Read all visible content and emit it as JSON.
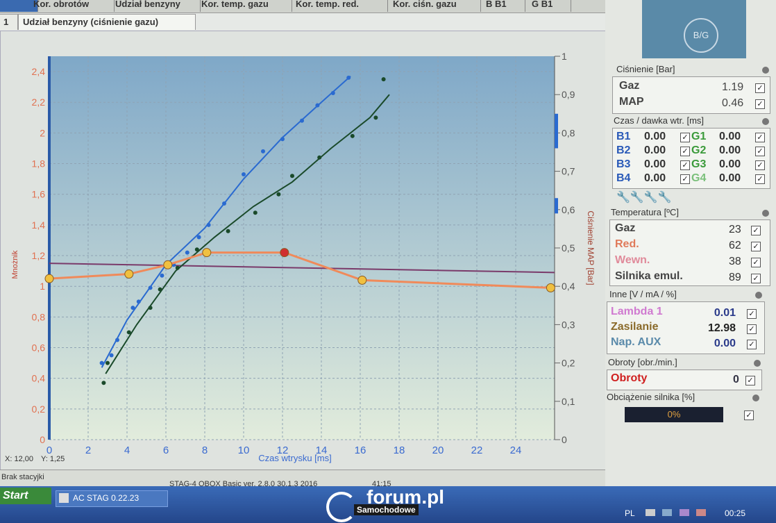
{
  "tabs": [
    "Kor. obrotów",
    "Udział benzyny",
    "Kor. temp. gazu",
    "Kor. temp. red.",
    "Kor. ciśn. gazu",
    "B B1",
    "G B1"
  ],
  "subtabs": [
    "1",
    "Udział benzyny (ciśnienie gazu)"
  ],
  "cursor_readout": {
    "x": "X: 12,00",
    "y": "Y: 1,25"
  },
  "status_left": "Brak stacyjki",
  "version": "STAG-4 QBOX Basic  ver. 2.8.0  30.1.3  2016",
  "time_partial": "41:15",
  "taskbar": {
    "start": "Start",
    "app": "AC STAG 0.22.23",
    "lang": "PL",
    "clock": "00:25"
  },
  "watermark": {
    "main": "forum.pl",
    "sub": "Samochodowe"
  },
  "logo": "B/G",
  "pressure": {
    "title": "Ciśnienie [Bar]",
    "rows": [
      {
        "label": "Gaz",
        "value": "1.19"
      },
      {
        "label": "MAP",
        "value": "0.46"
      }
    ]
  },
  "injection": {
    "title": "Czas / dawka wtr. [ms]",
    "rows": [
      {
        "b": "B1",
        "bv": "0.00",
        "g": "G1",
        "gv": "0.00"
      },
      {
        "b": "B2",
        "bv": "0.00",
        "g": "G2",
        "gv": "0.00"
      },
      {
        "b": "B3",
        "bv": "0.00",
        "g": "G3",
        "gv": "0.00"
      },
      {
        "b": "B4",
        "bv": "0.00",
        "g": "G4",
        "gv": "0.00"
      }
    ]
  },
  "temperature": {
    "title": "Temperatura [ºC]",
    "rows": [
      {
        "label": "Gaz",
        "value": "23",
        "color": "#444444"
      },
      {
        "label": "Red.",
        "value": "62",
        "color": "#e07a5a"
      },
      {
        "label": "Wewn.",
        "value": "38",
        "color": "#e08a9a"
      },
      {
        "label": "Silnika emul.",
        "value": "89",
        "color": "#444444"
      }
    ]
  },
  "other": {
    "title": "Inne [V / mA / %]",
    "rows": [
      {
        "label": "Lambda 1",
        "value": "0.01",
        "color": "#d07ad0"
      },
      {
        "label": "Zasilanie",
        "value": "12.98",
        "color": "#8a6a2a"
      },
      {
        "label": "Nap. AUX",
        "value": "0.00",
        "color": "#5a8aaa"
      }
    ]
  },
  "rpm": {
    "title": "Obroty [obr./min.]",
    "label": "Obroty",
    "value": "0"
  },
  "load": {
    "title": "Obciążenie silnika [%]",
    "value": "0%",
    "fraction": 0
  },
  "chart_data": {
    "type": "scatter",
    "xlabel": "Czas wtrysku [ms]",
    "ylabel_left": "Mnożnik",
    "ylabel_right": "Ciśnienie MAP [Bar]",
    "xlim": [
      0,
      26
    ],
    "ylim": [
      0,
      2.5
    ],
    "y2lim": [
      0,
      1
    ],
    "xticks": [
      0,
      2,
      4,
      6,
      8,
      10,
      12,
      14,
      16,
      18,
      20,
      22,
      24
    ],
    "yticks": [
      0,
      0.2,
      0.4,
      0.6,
      0.8,
      1,
      1.2,
      1.4,
      1.6,
      1.8,
      2,
      2.2,
      2.4
    ],
    "ytick_labels": [
      "0",
      "0,2",
      "0,4",
      "0,6",
      "0,8",
      "1",
      "1,2",
      "1,4",
      "1,6",
      "1,8",
      "2",
      "2,2",
      "2,4"
    ],
    "y2ticks": [
      0,
      0.1,
      0.2,
      0.3,
      0.4,
      0.5,
      0.6,
      0.7,
      0.8,
      0.9,
      1
    ],
    "y2tick_labels": [
      "0",
      "0,1",
      "0,2",
      "0,3",
      "0,4",
      "0,5",
      "0,6",
      "0,7",
      "0,8",
      "0,9",
      "1"
    ],
    "grid": true,
    "multiplier_curve": {
      "color": "#f08a5a",
      "points": [
        [
          0,
          1.05
        ],
        [
          4.1,
          1.08
        ],
        [
          6.1,
          1.14
        ],
        [
          8.1,
          1.22
        ],
        [
          12.1,
          1.22
        ],
        [
          16.1,
          1.04
        ],
        [
          25.8,
          0.99
        ]
      ],
      "highlight_index": 4
    },
    "map_line": {
      "color": "#7a3a6a",
      "y": [
        1.15,
        1.09
      ]
    },
    "blue_trend": {
      "color": "#2a6ad0",
      "points": [
        [
          2.7,
          0.47
        ],
        [
          4,
          0.78
        ],
        [
          6,
          1.14
        ],
        [
          8,
          1.38
        ],
        [
          10,
          1.7
        ],
        [
          12,
          1.97
        ],
        [
          14,
          2.2
        ],
        [
          15.5,
          2.37
        ]
      ]
    },
    "green_trend": {
      "color": "#1a4a2a",
      "points": [
        [
          2.9,
          0.43
        ],
        [
          4.5,
          0.75
        ],
        [
          6.5,
          1.1
        ],
        [
          8.5,
          1.32
        ],
        [
          10.5,
          1.52
        ],
        [
          12.5,
          1.68
        ],
        [
          14.5,
          1.9
        ],
        [
          16.5,
          2.1
        ],
        [
          17.5,
          2.25
        ]
      ]
    },
    "blue_points": [
      [
        2.7,
        0.5
      ],
      [
        3.2,
        0.55
      ],
      [
        3.5,
        0.65
      ],
      [
        4.3,
        0.86
      ],
      [
        4.6,
        0.9
      ],
      [
        5.2,
        0.99
      ],
      [
        5.8,
        1.07
      ],
      [
        6.4,
        1.14
      ],
      [
        7.1,
        1.22
      ],
      [
        7.7,
        1.32
      ],
      [
        8.2,
        1.4
      ],
      [
        9,
        1.54
      ],
      [
        10,
        1.73
      ],
      [
        11,
        1.88
      ],
      [
        12,
        1.96
      ],
      [
        13,
        2.08
      ],
      [
        13.8,
        2.18
      ],
      [
        14.6,
        2.26
      ],
      [
        15.4,
        2.36
      ]
    ],
    "green_points": [
      [
        2.8,
        0.37
      ],
      [
        3,
        0.5
      ],
      [
        4.1,
        0.7
      ],
      [
        5.2,
        0.86
      ],
      [
        5.7,
        0.98
      ],
      [
        6.6,
        1.12
      ],
      [
        7.6,
        1.24
      ],
      [
        9.2,
        1.36
      ],
      [
        10.6,
        1.48
      ],
      [
        11.8,
        1.6
      ],
      [
        12.5,
        1.72
      ],
      [
        13.9,
        1.84
      ],
      [
        15.6,
        1.98
      ],
      [
        16.8,
        2.1
      ],
      [
        17.2,
        2.35
      ]
    ],
    "series": [
      {
        "name": "Mnożnik",
        "color": "#f08a5a"
      },
      {
        "name": "Ciśnienie MAP",
        "color": "#7a3a6a"
      }
    ]
  },
  "colors": {
    "plot_bg_top": "#7fa8c8",
    "plot_bg_bottom": "#e2ecdc",
    "bank_b": "#2a5ab8",
    "bank_g": "#3a9a3a",
    "accent_red": "#d02020"
  }
}
